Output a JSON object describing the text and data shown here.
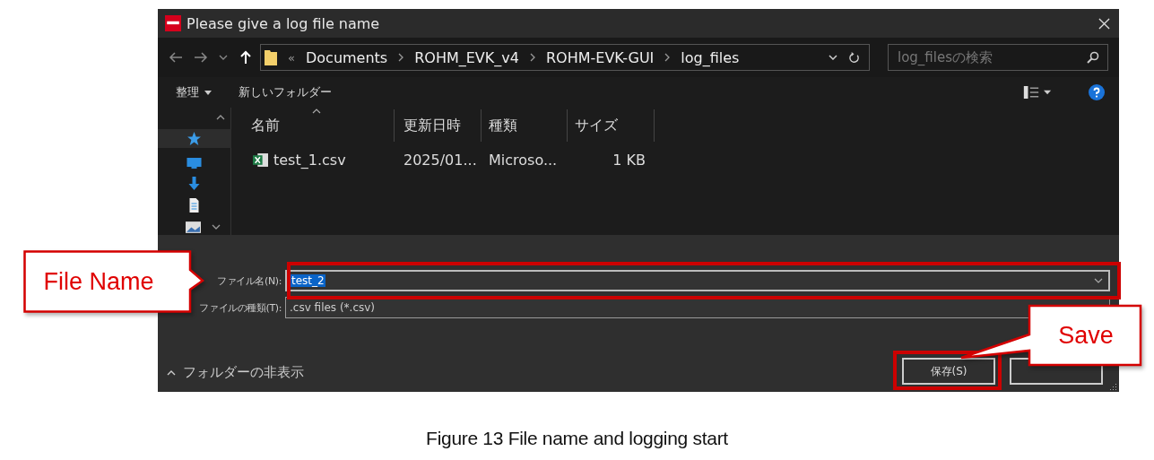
{
  "window": {
    "title": "Please give a log file name"
  },
  "address_bar": {
    "overflow": "«",
    "path": [
      "Documents",
      "ROHM_EVK_v4",
      "ROHM-EVK-GUI",
      "log_files"
    ]
  },
  "search": {
    "placeholder": "log_filesの検索"
  },
  "toolbar": {
    "organize": "整理",
    "new_folder": "新しいフォルダー"
  },
  "file_list": {
    "columns": [
      "名前",
      "更新日時",
      "種類",
      "サイズ"
    ],
    "rows": [
      {
        "name": "test_1.csv",
        "modified": "2025/01...",
        "type": "Microso...",
        "size": "1 KB"
      }
    ]
  },
  "file_name": {
    "label": "ファイル名(N):",
    "value": "test_2"
  },
  "file_type": {
    "label": "ファイルの種類(T):",
    "value": ".csv files (*.csv)"
  },
  "hide_folders": "フォルダーの非表示",
  "save_button": "保存(S)",
  "callouts": [
    {
      "text": "File Name"
    },
    {
      "text": "Save"
    }
  ],
  "caption": "Figure 13 File name and logging start"
}
